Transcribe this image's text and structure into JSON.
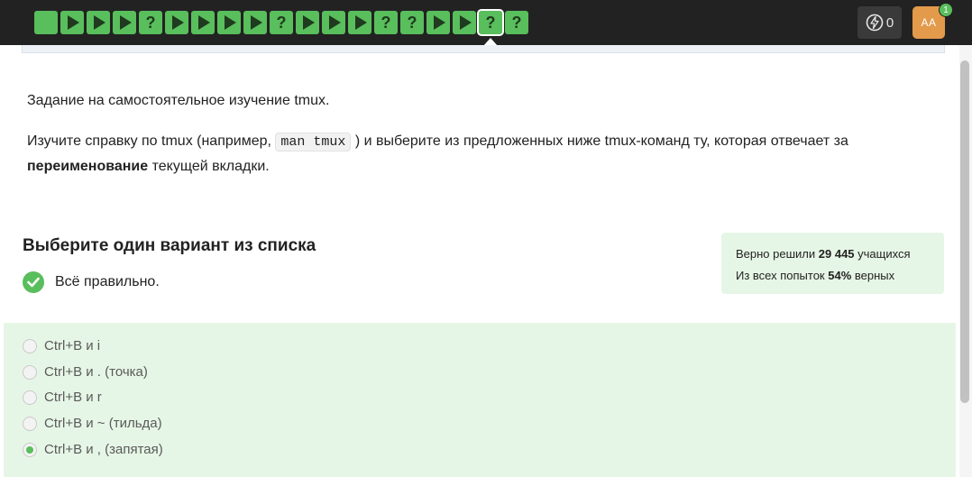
{
  "steps": [
    {
      "kind": "square"
    },
    {
      "kind": "play"
    },
    {
      "kind": "play"
    },
    {
      "kind": "play"
    },
    {
      "kind": "question"
    },
    {
      "kind": "play"
    },
    {
      "kind": "play"
    },
    {
      "kind": "play"
    },
    {
      "kind": "play"
    },
    {
      "kind": "question"
    },
    {
      "kind": "play"
    },
    {
      "kind": "play"
    },
    {
      "kind": "play"
    },
    {
      "kind": "question"
    },
    {
      "kind": "question"
    },
    {
      "kind": "play"
    },
    {
      "kind": "play"
    },
    {
      "kind": "question",
      "active": true
    },
    {
      "kind": "question"
    }
  ],
  "question_mark": "?",
  "header": {
    "energy_count": "0",
    "avatar_initials": "AA",
    "notification_count": "1"
  },
  "task": {
    "line1": "Задание на самостоятельное изучение tmux.",
    "line2_before": "Изучите справку по tmux (например, ",
    "code": "man tmux",
    "line2_after": " ) и выберите из предложенных ниже tmux-команд ту, которая отвечает за ",
    "bold": "переименование",
    "line2_end": " текущей вкладки."
  },
  "quiz": {
    "title": "Выберите один вариант из списка",
    "feedback": "Всё правильно."
  },
  "stats": {
    "line1_prefix": "Верно решили ",
    "solved_count": "29 445",
    "line1_suffix": " учащихся",
    "line2_prefix": "Из всех попыток ",
    "percent": "54%",
    "line2_suffix": " верных"
  },
  "options": [
    {
      "label": "Ctrl+B и i",
      "selected": false
    },
    {
      "label": "Ctrl+B и . (точка)",
      "selected": false
    },
    {
      "label": "Ctrl+B и r",
      "selected": false
    },
    {
      "label": "Ctrl+B и ~ (тильда)",
      "selected": false
    },
    {
      "label": "Ctrl+B и , (запятая)",
      "selected": true
    }
  ],
  "colors": {
    "accent_green": "#59be5c",
    "topbar": "#222222",
    "success_bg": "#e6f6e6",
    "avatar": "#e39a4b"
  }
}
